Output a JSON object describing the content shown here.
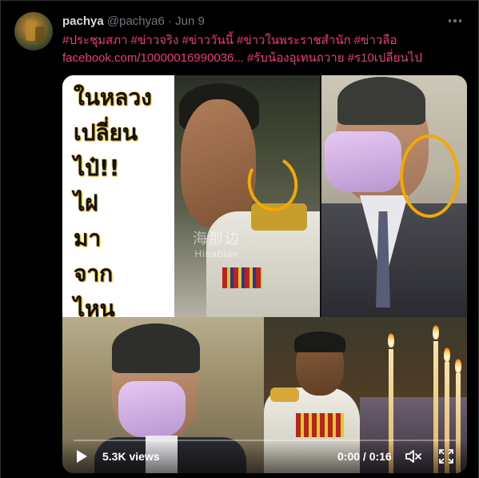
{
  "tweet": {
    "display_name": "pachya",
    "handle": "@pachya6",
    "separator": "·",
    "date": "Jun 9",
    "text_line1": "#ประชุมสภา #ข่าวจริง #ข่าววันนี้ #ข่าวในพระราชสำนัก #ข่าวลือ",
    "text_line2": "facebook.com/10000016990036... #รับน้องอุเทนถวาย #ร10เปลี่ยนไป"
  },
  "video": {
    "caption_lines": [
      "ในหลวง",
      "เปลี่ยน",
      "ไป๋!!",
      "ไฝ",
      "มา",
      "จาก",
      "ไหน"
    ],
    "watermark_cn": "海那边",
    "watermark_en": "Hinabian",
    "views": "5.3K views",
    "time": "0:00 / 0:16",
    "progress": 0.0
  },
  "colors": {
    "background": "#000000",
    "hashtag": "#f0347d",
    "muted": "#6e767d",
    "annotation_circle": "#f2a900"
  },
  "icons": [
    "more-icon",
    "play-icon",
    "mute-icon",
    "fullscreen-icon"
  ]
}
